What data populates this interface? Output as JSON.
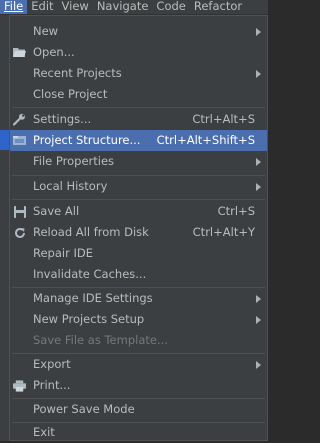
{
  "menubar": {
    "items": [
      {
        "label": "File"
      },
      {
        "label": "Edit"
      },
      {
        "label": "View"
      },
      {
        "label": "Navigate"
      },
      {
        "label": "Code"
      },
      {
        "label": "Refactor"
      }
    ]
  },
  "file_menu": {
    "items": [
      {
        "label": "New",
        "icon": "",
        "shortcut": "",
        "submenu": true
      },
      {
        "label": "Open...",
        "icon": "folder-icon",
        "shortcut": "",
        "submenu": false
      },
      {
        "label": "Recent Projects",
        "icon": "",
        "shortcut": "",
        "submenu": true
      },
      {
        "label": "Close Project",
        "icon": "",
        "shortcut": "",
        "submenu": false
      },
      {
        "label": "Settings...",
        "icon": "wrench-icon",
        "shortcut": "Ctrl+Alt+S",
        "submenu": false
      },
      {
        "label": "Project Structure...",
        "icon": "project-structure-icon",
        "shortcut": "Ctrl+Alt+Shift+S",
        "submenu": false,
        "selected": true
      },
      {
        "label": "File Properties",
        "icon": "",
        "shortcut": "",
        "submenu": true
      },
      {
        "label": "Local History",
        "icon": "",
        "shortcut": "",
        "submenu": true
      },
      {
        "label": "Save All",
        "icon": "save-icon",
        "shortcut": "Ctrl+S",
        "submenu": false
      },
      {
        "label": "Reload All from Disk",
        "icon": "reload-icon",
        "shortcut": "Ctrl+Alt+Y",
        "submenu": false
      },
      {
        "label": "Repair IDE",
        "icon": "",
        "shortcut": "",
        "submenu": false
      },
      {
        "label": "Invalidate Caches...",
        "icon": "",
        "shortcut": "",
        "submenu": false
      },
      {
        "label": "Manage IDE Settings",
        "icon": "",
        "shortcut": "",
        "submenu": true
      },
      {
        "label": "New Projects Setup",
        "icon": "",
        "shortcut": "",
        "submenu": true
      },
      {
        "label": "Save File as Template...",
        "icon": "",
        "shortcut": "",
        "submenu": false,
        "disabled": true
      },
      {
        "label": "Export",
        "icon": "",
        "shortcut": "",
        "submenu": true
      },
      {
        "label": "Print...",
        "icon": "printer-icon",
        "shortcut": "",
        "submenu": false
      },
      {
        "label": "Power Save Mode",
        "icon": "",
        "shortcut": "",
        "submenu": false
      },
      {
        "label": "Exit",
        "icon": "",
        "shortcut": "",
        "submenu": false
      }
    ]
  },
  "colors": {
    "menu_background": "#3c3f41",
    "selection": "#4b6eaf",
    "text": "#bbbbbb",
    "disabled_text": "#777777",
    "separator": "#515151"
  }
}
